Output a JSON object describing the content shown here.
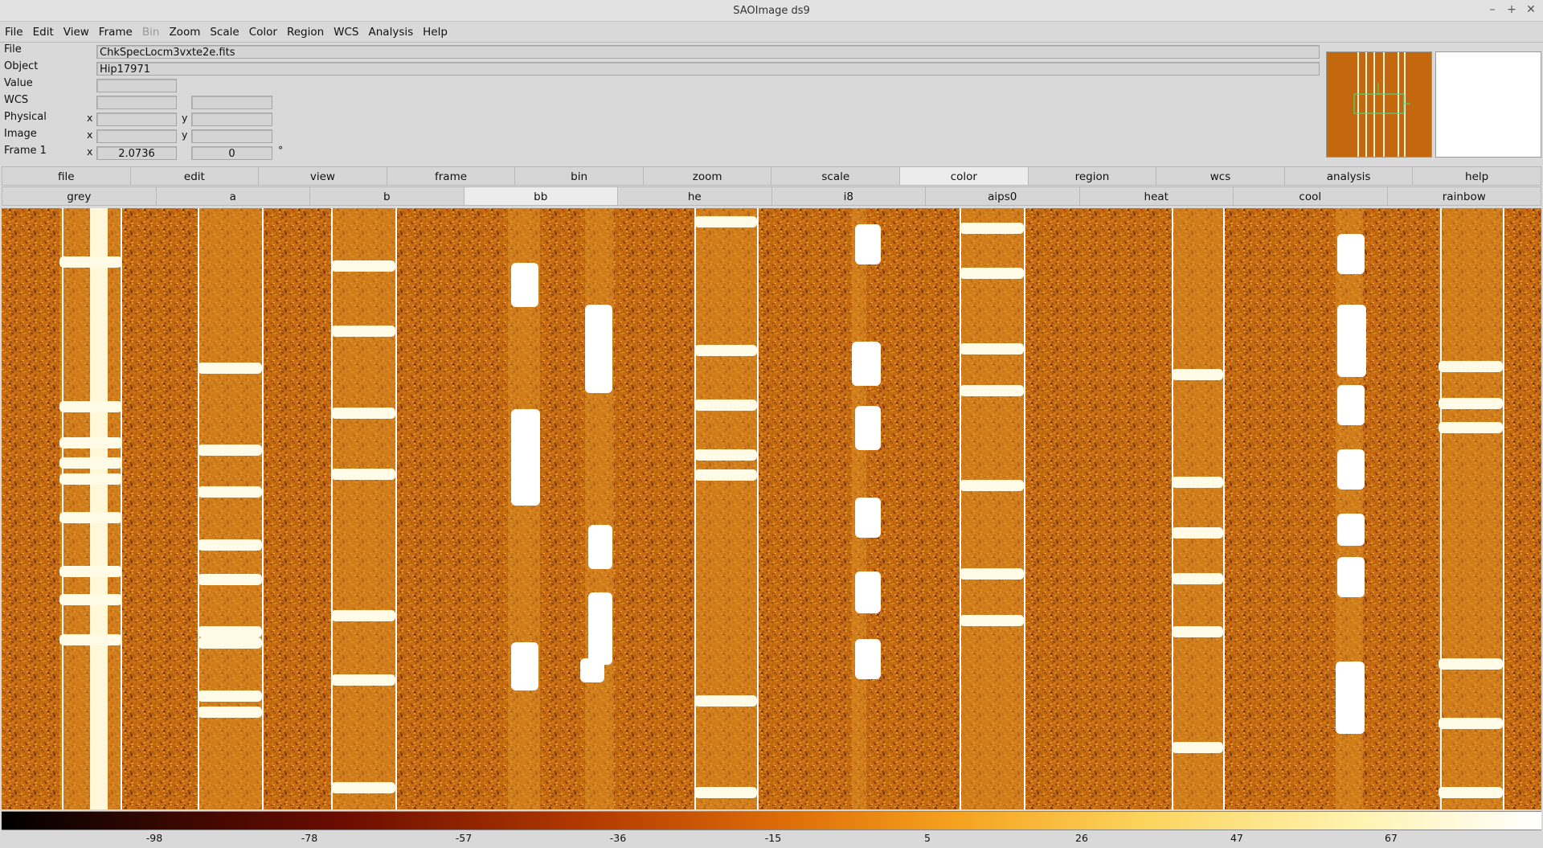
{
  "window": {
    "title": "SAOImage ds9",
    "buttons": [
      "–",
      "+",
      "✕"
    ]
  },
  "menubar": [
    {
      "label": "File",
      "enabled": true
    },
    {
      "label": "Edit",
      "enabled": true
    },
    {
      "label": "View",
      "enabled": true
    },
    {
      "label": "Frame",
      "enabled": true
    },
    {
      "label": "Bin",
      "enabled": false
    },
    {
      "label": "Zoom",
      "enabled": true
    },
    {
      "label": "Scale",
      "enabled": true
    },
    {
      "label": "Color",
      "enabled": true
    },
    {
      "label": "Region",
      "enabled": true
    },
    {
      "label": "WCS",
      "enabled": true
    },
    {
      "label": "Analysis",
      "enabled": true
    },
    {
      "label": "Help",
      "enabled": true
    }
  ],
  "info": {
    "file_label": "File",
    "file_value": "ChkSpecLocm3vxte2e.fits",
    "object_label": "Object",
    "object_value": "Hip17971",
    "value_label": "Value",
    "value_value": "",
    "wcs_label": "WCS",
    "wcs_value1": "",
    "wcs_value2": "",
    "physical_label": "Physical",
    "physical_x_label": "x",
    "physical_x": "",
    "physical_y_label": "y",
    "physical_y": "",
    "image_label": "Image",
    "image_x_label": "x",
    "image_x": "",
    "image_y_label": "y",
    "image_y": "",
    "frame_label": "Frame 1",
    "frame_x_label": "x",
    "frame_zoom": "2.0736",
    "frame_angle": "0",
    "frame_angle_unit": "°"
  },
  "buttonbar": [
    "file",
    "edit",
    "view",
    "frame",
    "bin",
    "zoom",
    "scale",
    "color",
    "region",
    "wcs",
    "analysis",
    "help"
  ],
  "buttonbar_active": "color",
  "colormaps": [
    "grey",
    "a",
    "b",
    "bb",
    "he",
    "i8",
    "aips0",
    "heat",
    "cool",
    "rainbow"
  ],
  "colormap_active": "bb",
  "colorbar": {
    "colormap": "bb",
    "ticks": [
      "-98",
      "-78",
      "-57",
      "-36",
      "-15",
      "5",
      "26",
      "47",
      "67"
    ]
  }
}
